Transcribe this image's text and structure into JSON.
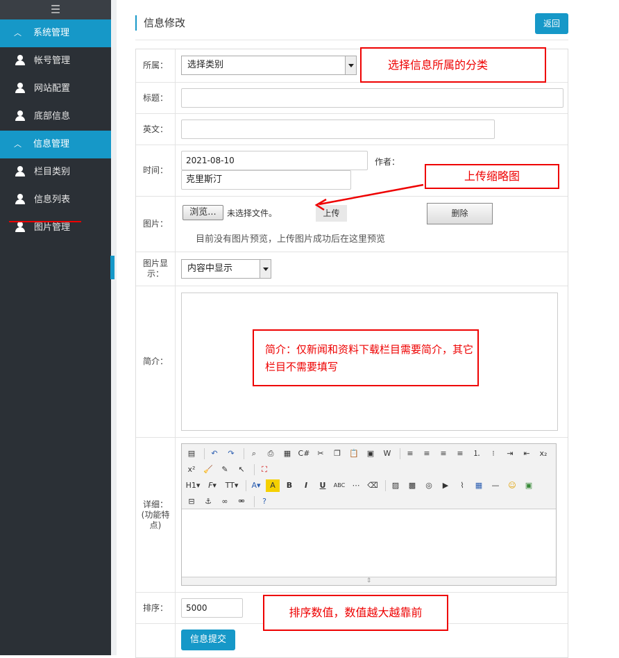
{
  "sidebar": {
    "menu_toggle": "☰",
    "groups": [
      {
        "label": "系统管理",
        "items": [
          "帐号管理",
          "网站配置",
          "底部信息"
        ]
      },
      {
        "label": "信息管理",
        "items": [
          "栏目类别",
          "信息列表",
          "图片管理"
        ]
      }
    ],
    "active_item": "信息列表"
  },
  "header": {
    "title": "信息修改",
    "back_label": "返回"
  },
  "form": {
    "category": {
      "label": "所属：",
      "selected": "选择类别"
    },
    "title": {
      "label": "标题：",
      "value": ""
    },
    "english": {
      "label": "英文：",
      "value": ""
    },
    "time": {
      "label": "时间：",
      "value": "2021-08-10",
      "author_label": "作者：",
      "author_value": "克里斯汀"
    },
    "image": {
      "label": "图片：",
      "browse_label": "浏览...",
      "file_status": "未选择文件。",
      "upload_label": "上传",
      "delete_label": "删除",
      "preview_hint": "目前没有图片预览，上传图片成功后在这里预览"
    },
    "image_display": {
      "label": "图片显示：",
      "selected": "内容中显示"
    },
    "summary": {
      "label": "简介：",
      "value": ""
    },
    "detail": {
      "label": "详细：(功能特点)"
    },
    "sort": {
      "label": "排序：",
      "value": "5000"
    },
    "submit_label": "信息提交"
  },
  "annotations": {
    "category_note": "选择信息所属的分类",
    "thumbnail_note": "上传缩略图",
    "summary_note": "简介：仅新闻和资料下载栏目需要简介，其它栏目不需要填写",
    "sort_note": "排序数值，数值越大越靠前"
  },
  "colors": {
    "accent": "#1698c8",
    "sidebar": "#2b3036",
    "annotation": "#e00000"
  }
}
